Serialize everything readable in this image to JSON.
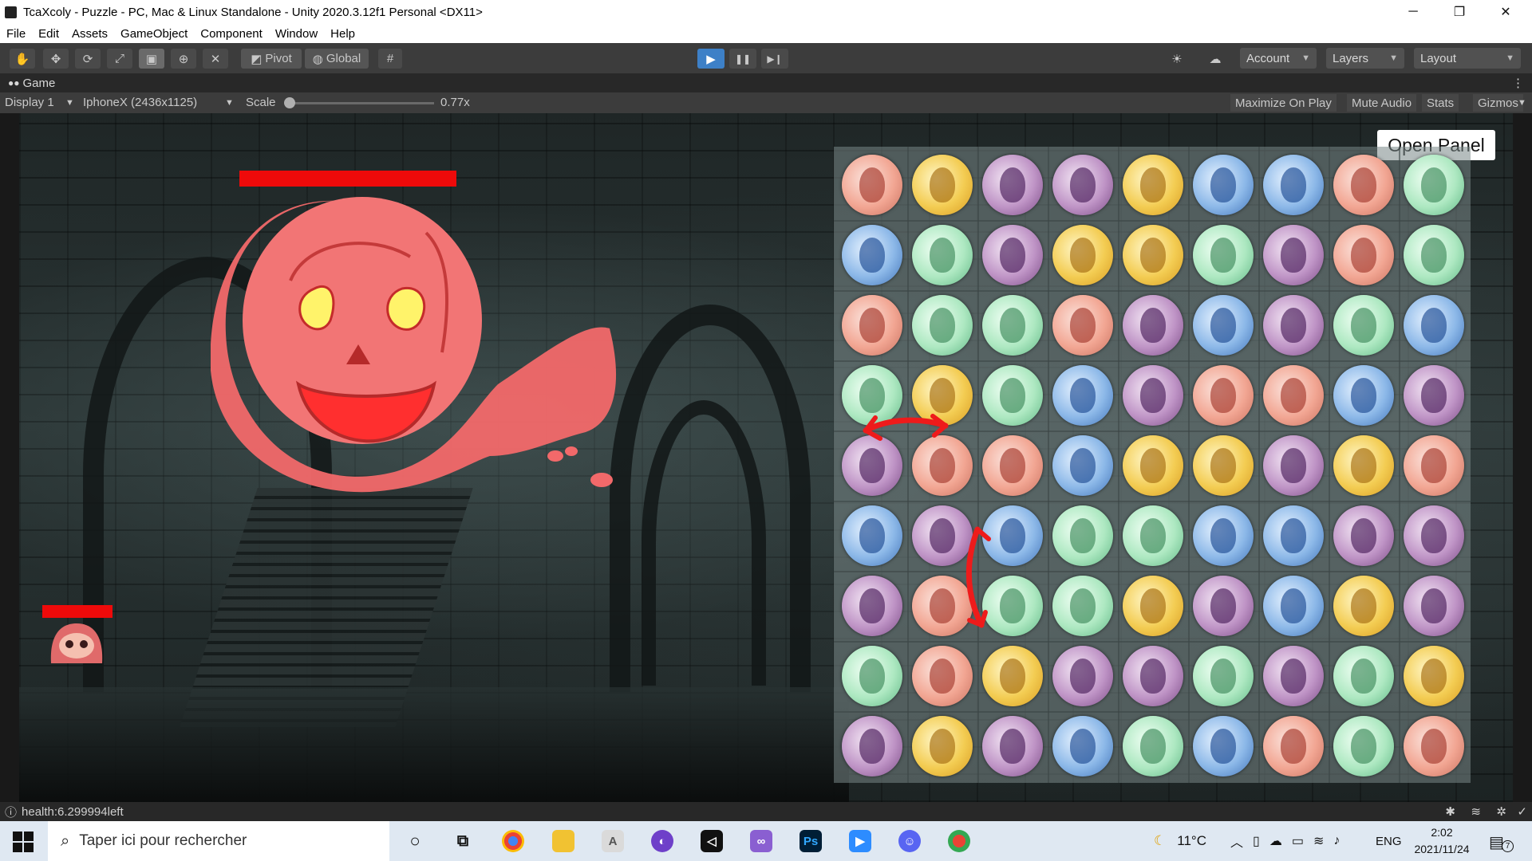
{
  "window": {
    "title": "TcaXcoly - Puzzle - PC, Mac & Linux Standalone - Unity 2020.3.12f1 Personal <DX11>",
    "minimize": "─",
    "maximize": "❐",
    "close": "✕"
  },
  "menu": [
    "File",
    "Edit",
    "Assets",
    "GameObject",
    "Component",
    "Window",
    "Help"
  ],
  "toolbar": {
    "pivot_label": "Pivot",
    "global_label": "Global",
    "account_label": "Account",
    "layers_label": "Layers",
    "layout_label": "Layout",
    "play_icon": "▶",
    "pause_icon": "❚❚",
    "step_icon": "▶❙"
  },
  "game_tab": {
    "label": "Game"
  },
  "game_bar": {
    "display": "Display 1",
    "resolution": "IphoneX (2436x1125)",
    "scale_label": "Scale",
    "scale_value": "0.77x",
    "scale_fraction": 0.0,
    "maximize_on_play": "Maximize On Play",
    "mute_audio": "Mute Audio",
    "stats": "Stats",
    "gizmos": "Gizmos"
  },
  "game": {
    "open_panel_label": "Open Panel",
    "board": {
      "rows": 9,
      "cols": 9,
      "grid": [
        [
          "red",
          "yellow",
          "purple",
          "purple",
          "yellow",
          "blue",
          "blue",
          "red",
          "green"
        ],
        [
          "blue",
          "green",
          "purple",
          "yellow",
          "yellow",
          "green",
          "purple",
          "red",
          "green"
        ],
        [
          "red",
          "green",
          "green",
          "red",
          "purple",
          "blue",
          "purple",
          "green",
          "blue"
        ],
        [
          "green",
          "yellow",
          "green",
          "blue",
          "purple",
          "red",
          "red",
          "blue",
          "purple"
        ],
        [
          "purple",
          "red",
          "red",
          "blue",
          "yellow",
          "yellow",
          "purple",
          "yellow",
          "red"
        ],
        [
          "blue",
          "purple",
          "blue",
          "green",
          "green",
          "blue",
          "blue",
          "purple",
          "purple"
        ],
        [
          "purple",
          "red",
          "green",
          "green",
          "yellow",
          "purple",
          "blue",
          "yellow",
          "purple"
        ],
        [
          "green",
          "red",
          "yellow",
          "purple",
          "purple",
          "green",
          "purple",
          "green",
          "yellow"
        ],
        [
          "purple",
          "yellow",
          "purple",
          "blue",
          "green",
          "blue",
          "red",
          "green",
          "red"
        ]
      ]
    },
    "gem_colors": {
      "red": "#f2a693",
      "yellow": "#f3cc52",
      "purple": "#bf94c6",
      "blue": "#8cb8e8",
      "green": "#ade8c1"
    },
    "health_color": "#ee0a0a",
    "ghost_color": "#f2696a"
  },
  "status": {
    "text": "health:6.299994left"
  },
  "taskbar": {
    "search_placeholder": "Taper ici pour rechercher",
    "weather": "11°C",
    "language": "ENG",
    "time": "2:02",
    "date": "2021/11/24",
    "notification_count": "7"
  }
}
